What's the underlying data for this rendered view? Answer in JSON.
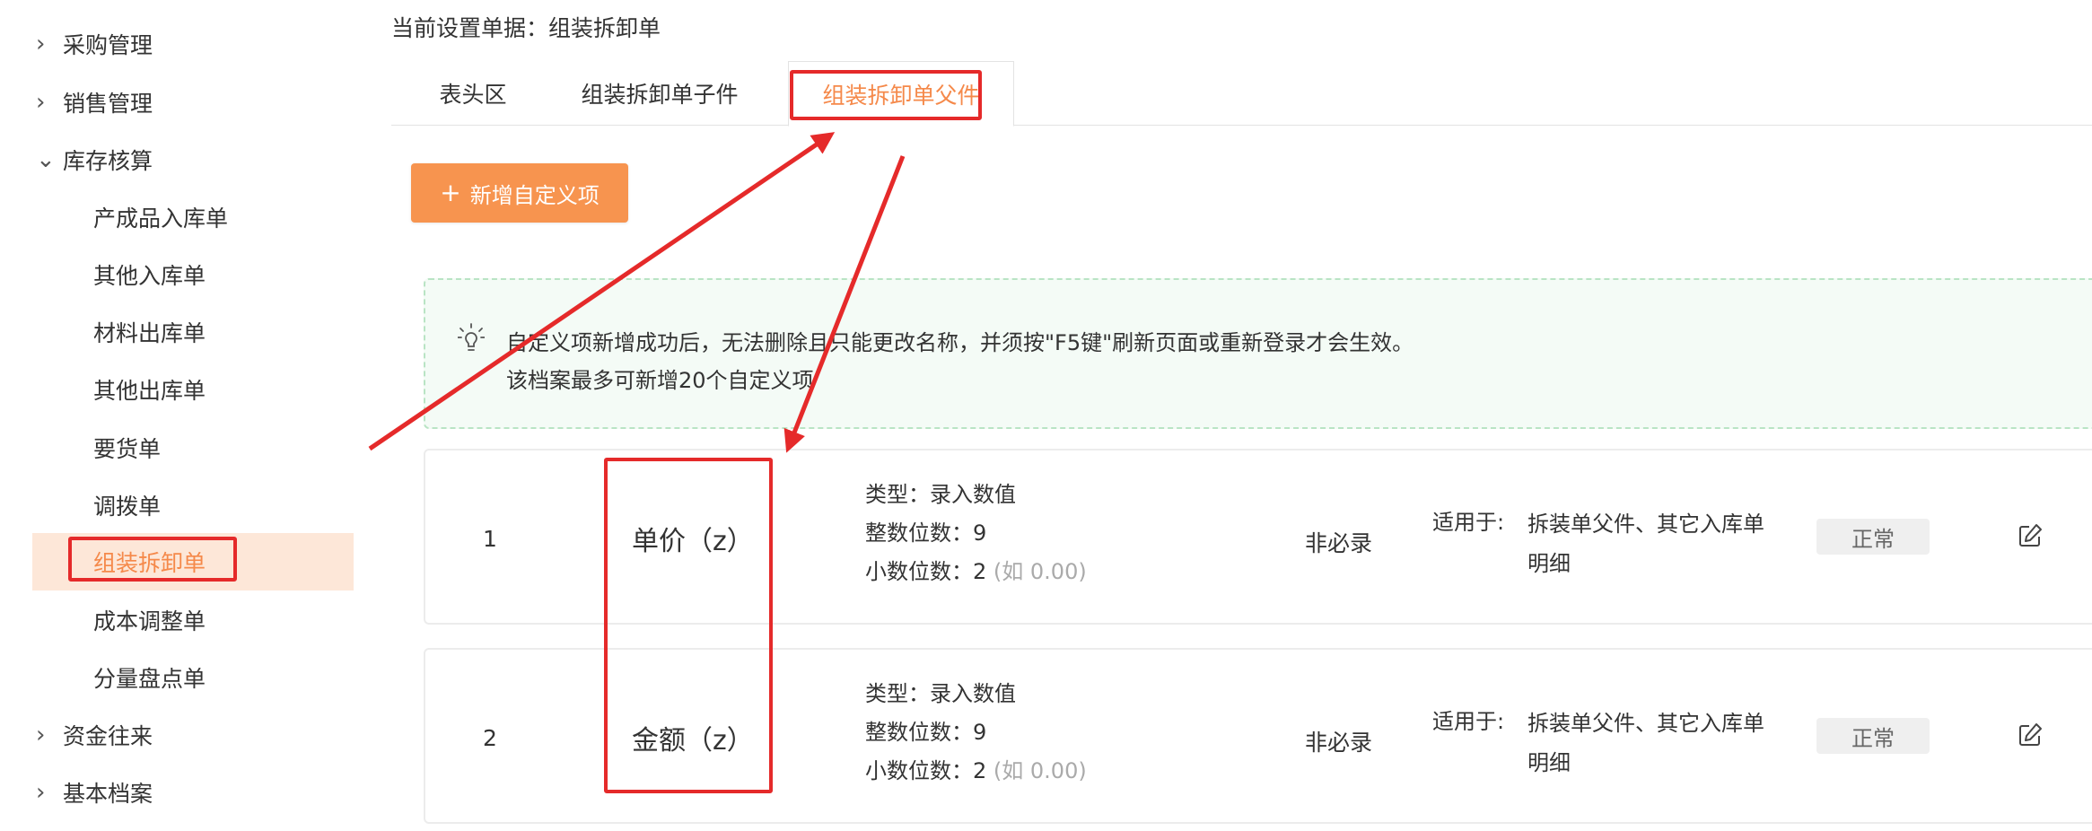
{
  "sidebar": {
    "groups_top": [
      {
        "label": "采购管理",
        "icon": "chevron-right-icon"
      },
      {
        "label": "销售管理",
        "icon": "chevron-right-icon"
      },
      {
        "label": "库存核算",
        "icon": "chevron-down-icon"
      }
    ],
    "children": [
      {
        "label": "产成品入库单"
      },
      {
        "label": "其他入库单"
      },
      {
        "label": "材料出库单"
      },
      {
        "label": "其他出库单"
      },
      {
        "label": "要货单"
      },
      {
        "label": "调拨单"
      },
      {
        "label": "组装拆卸单",
        "active": true
      },
      {
        "label": "成本调整单"
      },
      {
        "label": "分量盘点单"
      }
    ],
    "groups_bottom": [
      {
        "label": "资金往来",
        "icon": "chevron-right-icon"
      },
      {
        "label": "基本档案",
        "icon": "chevron-right-icon"
      }
    ]
  },
  "main": {
    "setting_label": "当前设置单据：",
    "setting_value": "组装拆卸单",
    "tabs": [
      {
        "label": "表头区"
      },
      {
        "label": "组装拆卸单子件"
      },
      {
        "label": "组装拆卸单父件",
        "active": true
      }
    ],
    "add_button": "新增自定义项",
    "tip": {
      "icon": "lightbulb-icon",
      "line1": "自定义项新增成功后，无法删除且只能更改名称，并须按\"F5键\"刷新页面或重新登录才会生效。",
      "line2": "该档案最多可新增20个自定义项"
    },
    "rows": [
      {
        "no": "1",
        "name": "单价（z）",
        "type_label": "类型：",
        "type_value": "录入数值",
        "int_label": "整数位数：",
        "int_value": "9",
        "dec_label": "小数位数：",
        "dec_value": "2",
        "dec_hint": "(如 0.00)",
        "required": "非必录",
        "apply_label": "适用于:",
        "apply_value": "拆装单父件、其它入库单明细",
        "status": "正常"
      },
      {
        "no": "2",
        "name": "金额（z）",
        "type_label": "类型：",
        "type_value": "录入数值",
        "int_label": "整数位数：",
        "int_value": "9",
        "dec_label": "小数位数：",
        "dec_value": "2",
        "dec_hint": "(如 0.00)",
        "required": "非必录",
        "apply_label": "适用于:",
        "apply_value": "拆装单父件、其它入库单明细",
        "status": "正常"
      }
    ]
  },
  "colors": {
    "accent": "#f5894a",
    "button": "#f7944f",
    "annotation_red": "#e52a2a",
    "active_bg": "#fde7d8",
    "tip_bg": "#f4fbf6",
    "tip_border": "#b9e4c4"
  }
}
